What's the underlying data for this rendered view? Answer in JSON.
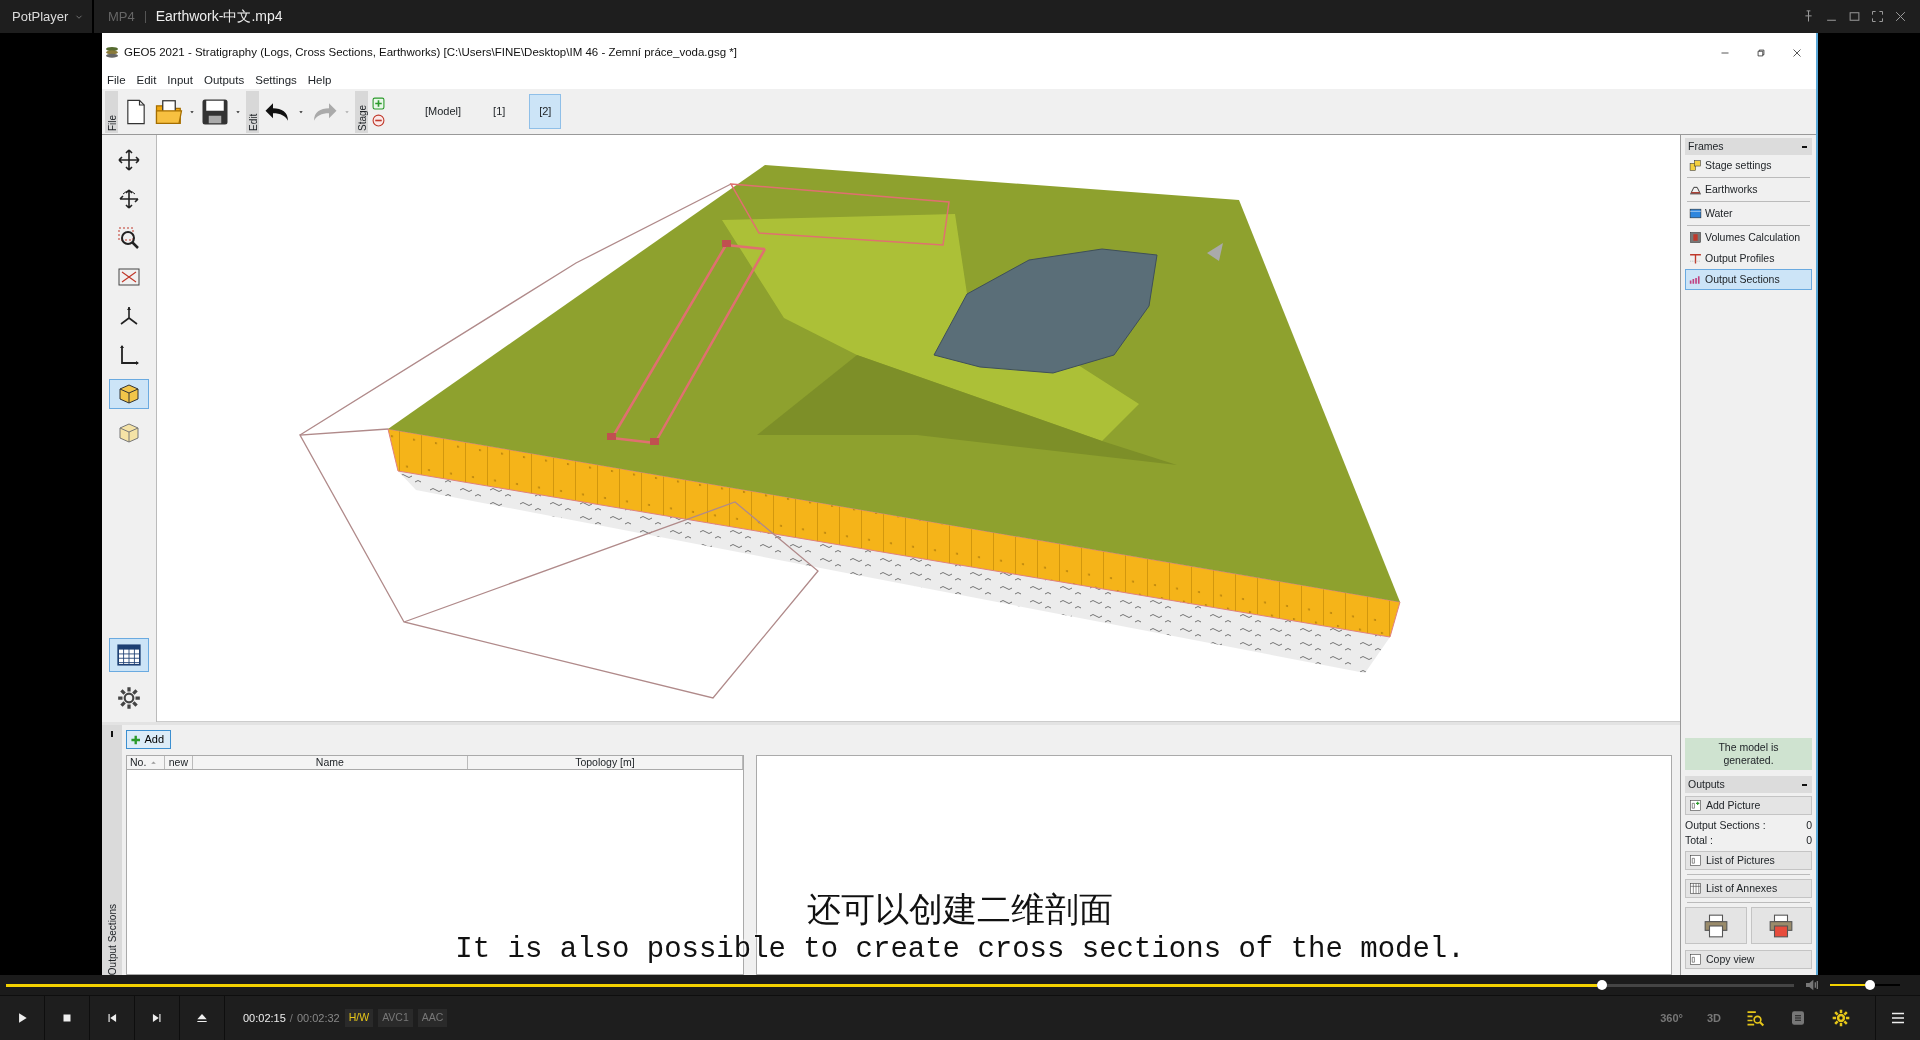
{
  "player": {
    "app_name": "PotPlayer",
    "format": "MP4",
    "file_title": "Earthwork-中文.mp4",
    "elapsed": "00:02:15",
    "separator": "/",
    "duration": "00:02:32",
    "badges": [
      {
        "label": "H/W",
        "active": true
      },
      {
        "label": "AVC1",
        "active": false
      },
      {
        "label": "AAC",
        "active": false
      }
    ],
    "seek": {
      "level": 0.89
    },
    "volume": {
      "level": 0.5
    },
    "view_buttons": [
      "360°",
      "3D"
    ],
    "subtitles": [
      "还可以创建二维剖面",
      "It is also possible to create cross sections of the model."
    ]
  },
  "window": {
    "title": "GEO5 2021 - Stratigraphy (Logs, Cross Sections, Earthworks) [C:\\Users\\FINE\\Desktop\\IM 46 - Zemní práce_voda.gsg *]"
  },
  "menu": [
    "File",
    "Edit",
    "Input",
    "Outputs",
    "Settings",
    "Help"
  ],
  "toolbar": {
    "group_labels": [
      "File",
      "Edit",
      "Stage"
    ],
    "stages": [
      {
        "label": "[Model]",
        "selected": false
      },
      {
        "label": "[1]",
        "selected": false
      },
      {
        "label": "[2]",
        "selected": true
      }
    ]
  },
  "tools": [
    {
      "selected": false
    },
    {
      "selected": false
    },
    {
      "selected": false
    },
    {
      "selected": false
    },
    {
      "selected": false
    },
    {
      "selected": false
    },
    {
      "selected": true
    },
    {
      "selected": false
    }
  ],
  "bottom_tools": [
    {
      "selected": true
    },
    {
      "selected": false
    }
  ],
  "frames": {
    "title": "Frames",
    "items": [
      {
        "label": "Stage settings",
        "selected": false
      },
      {
        "label": "Earthworks",
        "selected": false
      },
      {
        "label": "Water",
        "selected": false
      },
      {
        "label": "Volumes Calculation",
        "selected": false
      },
      {
        "label": "Output Profiles",
        "selected": false
      },
      {
        "label": "Output Sections",
        "selected": true
      }
    ]
  },
  "status": "The model is generated.",
  "outputs": {
    "title": "Outputs",
    "add_picture": "Add Picture",
    "counts": [
      {
        "label": "Output Sections :",
        "value": "0"
      },
      {
        "label": "Total :",
        "value": "0"
      }
    ],
    "list_pictures": "List of Pictures",
    "list_annexes": "List of Annexes",
    "copy_view": "Copy view"
  },
  "bottom": {
    "side_label": "Output Sections",
    "add_button": "Add",
    "columns": [
      "No.",
      "new",
      "Name",
      "Topology [m]"
    ]
  }
}
